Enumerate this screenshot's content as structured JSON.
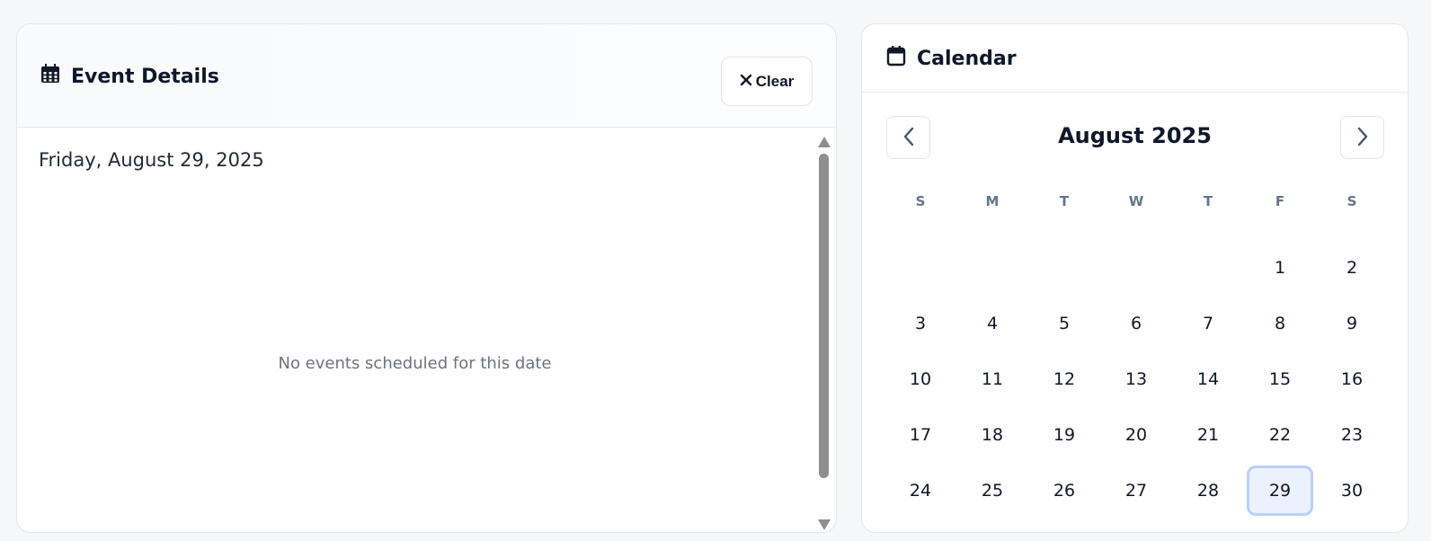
{
  "events": {
    "title": "Event Details",
    "title_icon": "calendar-grid-icon",
    "clear_label": "Clear",
    "clear_icon": "close-icon",
    "selected_date_text": "Friday, August 29, 2025",
    "empty_message": "No events scheduled for this date"
  },
  "calendar": {
    "title": "Calendar",
    "title_icon": "calendar-icon",
    "month_label": "August 2025",
    "prev_icon": "chevron-left-icon",
    "next_icon": "chevron-right-icon",
    "weekdays": [
      "S",
      "M",
      "T",
      "W",
      "T",
      "F",
      "S"
    ],
    "leading_blank_days": 5,
    "days": [
      "1",
      "2",
      "3",
      "4",
      "5",
      "6",
      "7",
      "8",
      "9",
      "10",
      "11",
      "12",
      "13",
      "14",
      "15",
      "16",
      "17",
      "18",
      "19",
      "20",
      "21",
      "22",
      "23",
      "24",
      "25",
      "26",
      "27",
      "28",
      "29",
      "30"
    ],
    "selected_day": "29"
  },
  "colors": {
    "accent_bg": "#eaf2ff",
    "accent_border": "#b7d1fb",
    "muted_text": "#6b7280"
  }
}
